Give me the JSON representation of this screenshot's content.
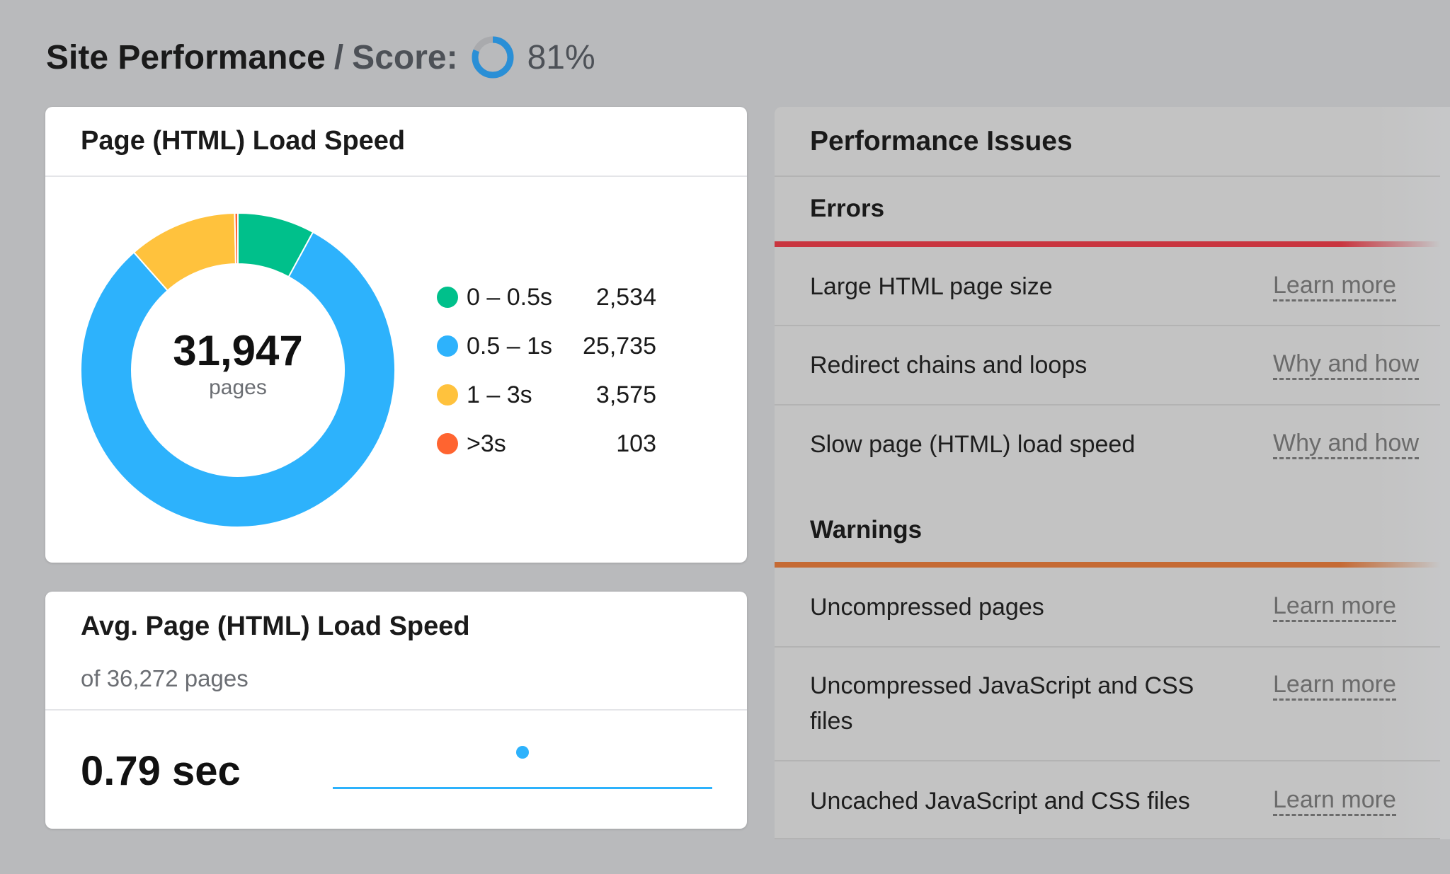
{
  "header": {
    "title": "Site Performance",
    "separator": "/",
    "score_label": "Score:",
    "score_value": "81%",
    "score_fraction": 0.81,
    "score_color": "#2a8fd6"
  },
  "load_speed_card": {
    "title": "Page (HTML) Load Speed",
    "total": "31,947",
    "total_unit": "pages",
    "chart_data": {
      "type": "pie",
      "categories": [
        "0 – 0.5s",
        "0.5 – 1s",
        "1 – 3s",
        ">3s"
      ],
      "values": [
        2534,
        25735,
        3575,
        103
      ],
      "labels": [
        "2,534",
        "25,735",
        "3,575",
        "103"
      ],
      "colors": [
        "#00c08b",
        "#2db2fc",
        "#ffc23d",
        "#ff6430"
      ],
      "donut": true
    }
  },
  "avg_card": {
    "title": "Avg. Page (HTML) Load Speed",
    "subtitle": "of 36,272 pages",
    "value": "0.79 sec",
    "line_color": "#2db2fc"
  },
  "issues": {
    "title": "Performance Issues",
    "errors": {
      "label": "Errors",
      "color": "#c9353f",
      "items": [
        {
          "name": "Large HTML page size",
          "link": "Learn more"
        },
        {
          "name": "Redirect chains and loops",
          "link": "Why and how"
        },
        {
          "name": "Slow page (HTML) load speed",
          "link": "Why and how"
        }
      ]
    },
    "warnings": {
      "label": "Warnings",
      "color": "#c56a34",
      "items": [
        {
          "name": "Uncompressed pages",
          "link": "Learn more"
        },
        {
          "name": "Uncompressed JavaScript and CSS files",
          "link": "Learn more"
        },
        {
          "name": "Uncached JavaScript and CSS files",
          "link": "Learn more"
        }
      ]
    }
  }
}
